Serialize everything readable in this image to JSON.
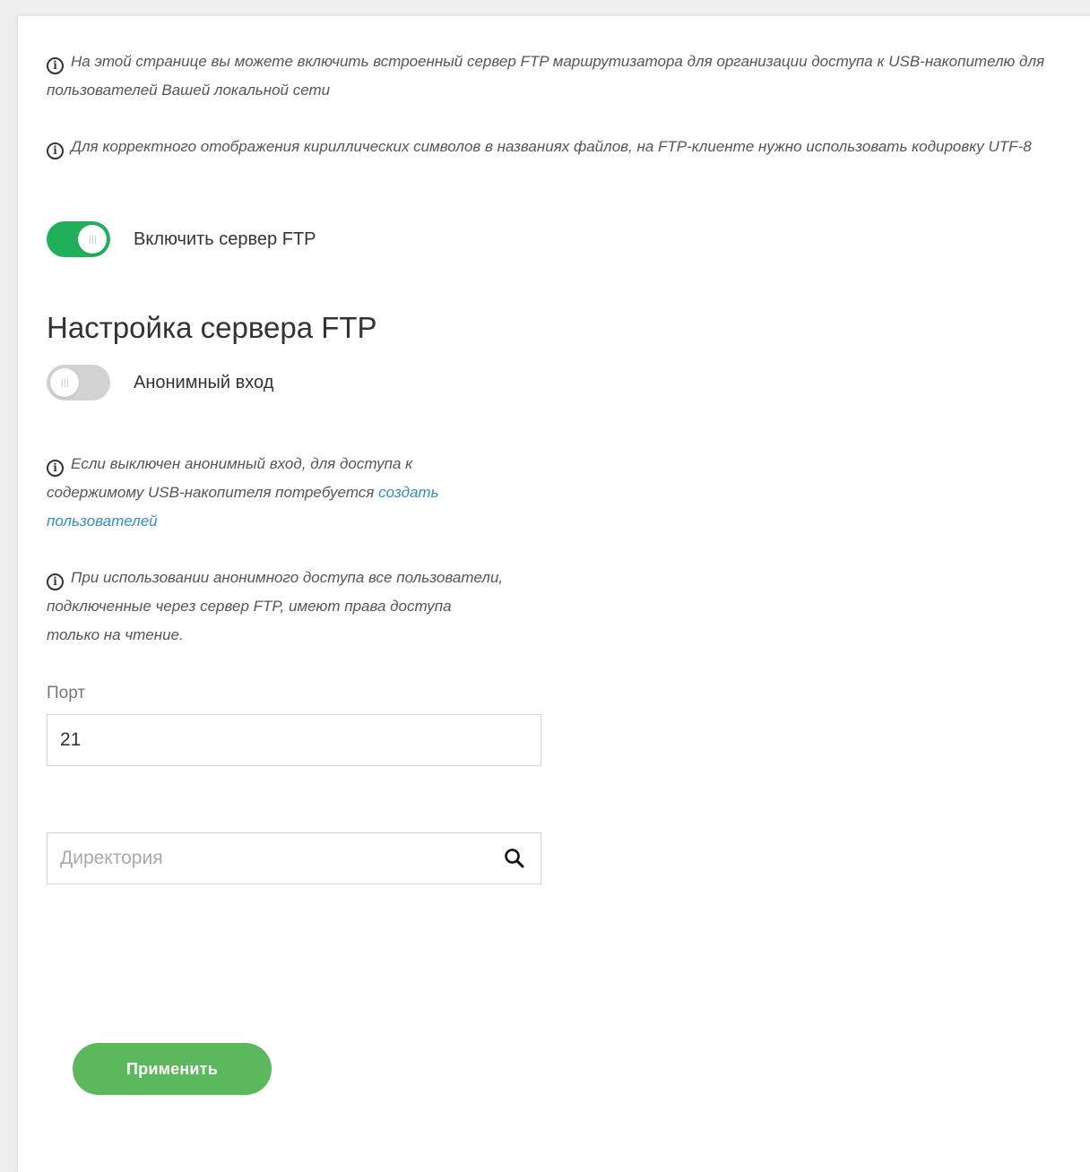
{
  "info_messages": {
    "usb_access": "На этой странице вы можете включить встроенный сервер FTP маршрутизатора для организации доступа к USB-накопителю для пользователей Вашей локальной сети",
    "encoding": "Для корректного отображения кириллических символов в названиях файлов, на FTP-клиенте нужно использовать кодировку UTF-8",
    "anonymous_off": "Если выключен анонимный вход, для доступа к содержимому USB-накопителя потребуется",
    "anonymous_off_link": "создать пользователей",
    "anonymous_readonly": "При использовании анонимного доступа все пользователи, подключенные через сервер FTP, имеют права доступа только на чтение."
  },
  "enable_ftp": {
    "label": "Включить сервер FTP",
    "state": "on"
  },
  "section": {
    "title": "Настройка сервера FTP"
  },
  "anonymous_login": {
    "label": "Анонимный вход",
    "state": "off"
  },
  "port": {
    "label": "Порт",
    "value": "21"
  },
  "directory": {
    "placeholder": "Директория",
    "value": ""
  },
  "apply_button": {
    "label": "Применить"
  },
  "colors": {
    "toggle_on": "#21b05a",
    "toggle_off": "#d2d2d2",
    "button": "#5cb85c",
    "link": "#2f8fc7"
  },
  "icons": {
    "info": "info-circle-icon",
    "search": "search-icon"
  }
}
